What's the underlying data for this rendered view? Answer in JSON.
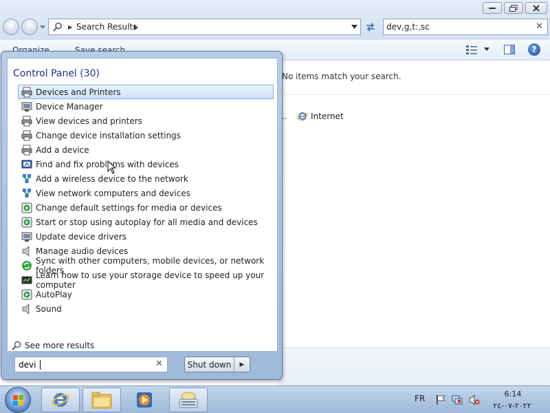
{
  "window": {
    "address_crumb": "Search Results",
    "search_value": "dev,g,t:,sc",
    "toolbar": {
      "organize": "Organize",
      "save_search": "Save search"
    },
    "content": {
      "no_items": "No items match your search.",
      "ellipsis": "..",
      "internet": "Internet"
    }
  },
  "start_menu": {
    "header": "Control Panel (30)",
    "items": [
      {
        "label": "Devices and Printers",
        "icon": "printer-icon"
      },
      {
        "label": "Device Manager",
        "icon": "device-manager-icon"
      },
      {
        "label": "View devices and printers",
        "icon": "printer-icon"
      },
      {
        "label": "Change device installation settings",
        "icon": "printer-icon"
      },
      {
        "label": "Add a device",
        "icon": "printer-icon"
      },
      {
        "label": "Find and fix problems with devices",
        "icon": "troubleshoot-icon"
      },
      {
        "label": "Add a wireless device to the network",
        "icon": "network-icon"
      },
      {
        "label": "View network computers and devices",
        "icon": "network-icon"
      },
      {
        "label": "Change default settings for media or devices",
        "icon": "autoplay-icon"
      },
      {
        "label": "Start or stop using autoplay for all media and devices",
        "icon": "autoplay-icon"
      },
      {
        "label": "Update device drivers",
        "icon": "device-manager-icon"
      },
      {
        "label": "Manage audio devices",
        "icon": "speaker-icon"
      },
      {
        "label": "Sync with other computers, mobile devices, or network folders",
        "icon": "sync-icon"
      },
      {
        "label": "Learn how to use your storage device to speed up your computer",
        "icon": "performance-icon"
      },
      {
        "label": "AutoPlay",
        "icon": "autoplay-icon"
      },
      {
        "label": "Sound",
        "icon": "speaker-icon"
      }
    ],
    "see_more": "See more results",
    "search_value": "devi",
    "shutdown_label": "Shut down"
  },
  "taskbar": {
    "language": "FR",
    "time": "6:14",
    "date": "٢٠٢٢-٠٧-٢٤"
  }
}
